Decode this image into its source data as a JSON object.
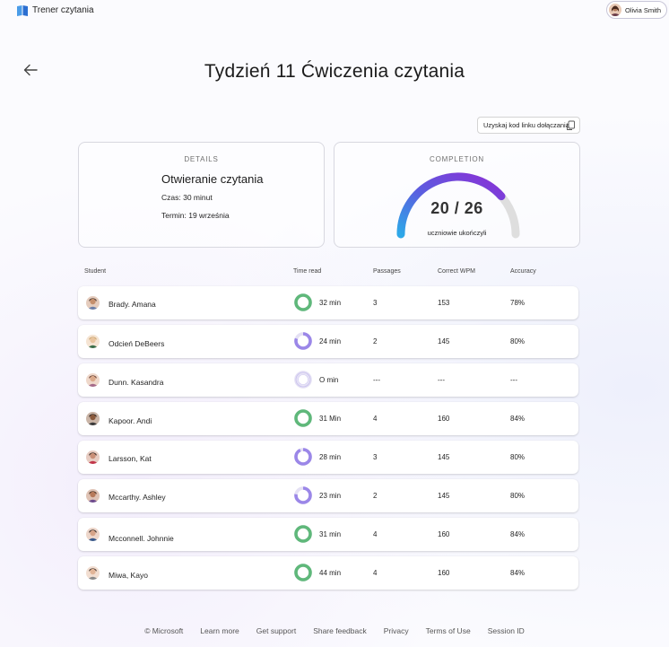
{
  "app": {
    "title": "Trener czytania"
  },
  "user": {
    "name": "Olivia Smith"
  },
  "page": {
    "title": "Tydzień 11 Ćwiczenia czytania",
    "join_button": "Uzyskaj kod linku dołączania"
  },
  "details": {
    "label": "DETAILS",
    "title": "Otwieranie czytania",
    "duration": "Czas: 30 minut",
    "due": "Termin: 19 września"
  },
  "completion": {
    "label": "COMPLETION",
    "count": "20 / 26",
    "caption": "uczniowie ukończyli",
    "fraction": 0.77
  },
  "table": {
    "headers": {
      "student": "Student",
      "time": "Time read",
      "passages": "Passages",
      "wpm": "Correct WPM",
      "accuracy": "Accuracy"
    },
    "rows": [
      {
        "name": "Brady. Amana",
        "time": "32 min",
        "passages": "3",
        "wpm": "153",
        "accuracy": "78%",
        "progress": 1.0,
        "ring_color": "#5fb87a"
      },
      {
        "name": "Odcień DeBeers",
        "time": "24 min",
        "passages": "2",
        "wpm": "145",
        "accuracy": "80%",
        "progress": 0.8,
        "ring_color": "#9b87e8"
      },
      {
        "name": "Dunn. Kasandra",
        "time": "O min",
        "passages": "---",
        "wpm": "---",
        "accuracy": "---",
        "progress": 0.0,
        "ring_color": "#9b87e8"
      },
      {
        "name": "Kapoor. Andi",
        "time": "31 Min",
        "passages": "4",
        "wpm": "160",
        "accuracy": "84%",
        "progress": 1.0,
        "ring_color": "#5fb87a"
      },
      {
        "name": "Larsson, Kat",
        "time": "28 min",
        "passages": "3",
        "wpm": "145",
        "accuracy": "80%",
        "progress": 0.93,
        "ring_color": "#9b87e8"
      },
      {
        "name": "Mccarthy. Ashley",
        "time": "23 min",
        "passages": "2",
        "wpm": "145",
        "accuracy": "80%",
        "progress": 0.77,
        "ring_color": "#9b87e8"
      },
      {
        "name": "Mcconnell. Johnnie",
        "time": "31 min",
        "passages": "4",
        "wpm": "160",
        "accuracy": "84%",
        "progress": 1.0,
        "ring_color": "#5fb87a"
      },
      {
        "name": "Miwa, Kayo",
        "time": "44 min",
        "passages": "4",
        "wpm": "160",
        "accuracy": "84%",
        "progress": 1.0,
        "ring_color": "#5fb87a"
      }
    ]
  },
  "footer": {
    "links": [
      "© Microsoft",
      "Learn more",
      "Get support",
      "Share feedback",
      "Privacy",
      "Terms of Use",
      "Session ID"
    ]
  }
}
